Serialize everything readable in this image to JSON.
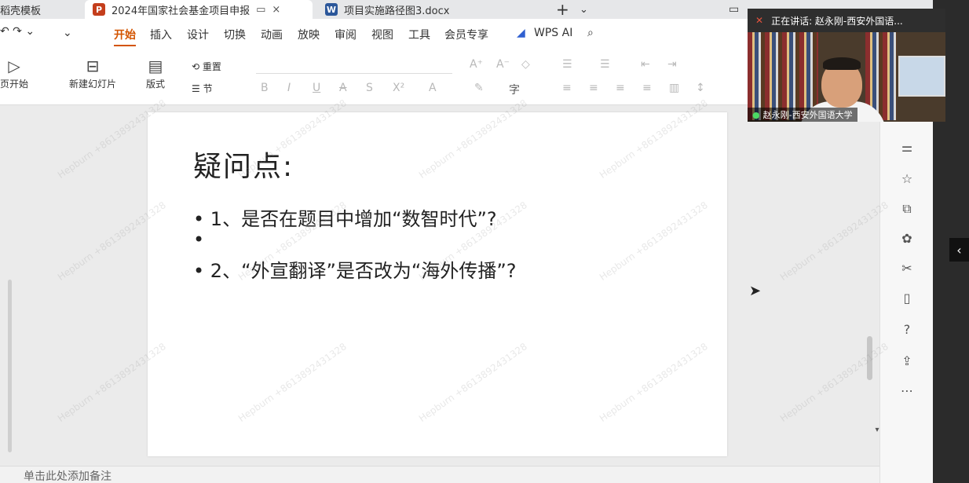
{
  "tabs": [
    {
      "label": "稻壳模板",
      "icon": "",
      "active": false
    },
    {
      "label": "2024年国家社会基金项目申报",
      "icon": "P",
      "active": true
    },
    {
      "label": "项目实施路径图3.docx",
      "icon": "W",
      "active": false
    }
  ],
  "tab_actions": {
    "new_tab": "+",
    "dropdown": "⌄",
    "close": "×",
    "pin": "▭"
  },
  "menu": [
    "开始",
    "插入",
    "设计",
    "切换",
    "动画",
    "放映",
    "审阅",
    "视图",
    "工具",
    "会员专享"
  ],
  "menu_active": "开始",
  "wps_ai": "WPS AI",
  "toolbar": {
    "play_label": "页开始",
    "new_slide": "新建幻灯片",
    "layout": "版式",
    "reset": "重置",
    "section": "节"
  },
  "slide": {
    "title": "疑问点:",
    "bullets": [
      "1、是否在题目中增加“数智时代”?",
      "",
      "2、“外宣翻译”是否改为“海外传播”?"
    ]
  },
  "notes_placeholder": "单击此处添加备注",
  "video": {
    "speaking": "正在讲话: 赵永刚-西安外国语...",
    "name": "赵永刚-西安外国语大学"
  },
  "watermark": "Hepburn +8613892431328",
  "colors": {
    "accent": "#d35400",
    "ppt_icon": "#c43e1c",
    "word_icon": "#2b579a"
  }
}
